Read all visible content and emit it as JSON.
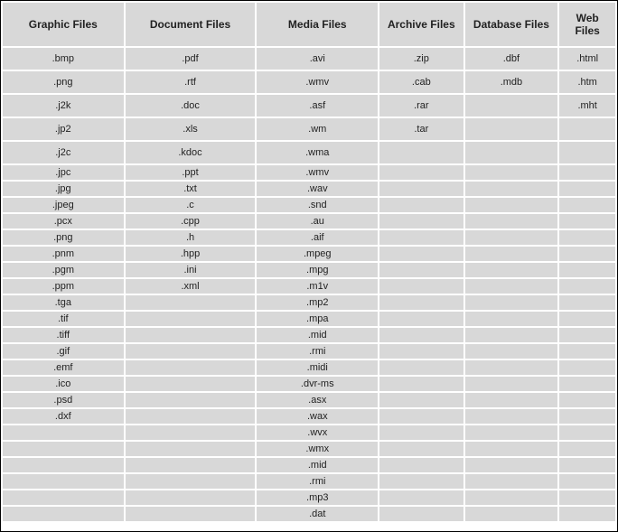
{
  "headers": [
    "Graphic Files",
    "Document Files",
    "Media Files",
    "Archive Files",
    "Database Files",
    "Web Files"
  ],
  "rows": [
    {
      "tall": true,
      "cells": [
        ".bmp",
        ".pdf",
        ".avi",
        ".zip",
        ".dbf",
        ".html"
      ]
    },
    {
      "tall": true,
      "cells": [
        ".png",
        ".rtf",
        ".wmv",
        ".cab",
        ".mdb",
        ".htm"
      ]
    },
    {
      "tall": true,
      "cells": [
        ".j2k",
        ".doc",
        ".asf",
        ".rar",
        "",
        ".mht"
      ]
    },
    {
      "tall": true,
      "cells": [
        ".jp2",
        ".xls",
        ".wm",
        ".tar",
        "",
        ""
      ]
    },
    {
      "tall": true,
      "cells": [
        ".j2c",
        ".kdoc",
        ".wma",
        "",
        "",
        ""
      ]
    },
    {
      "tall": false,
      "cells": [
        ".jpc",
        ".ppt",
        ".wmv",
        "",
        "",
        ""
      ]
    },
    {
      "tall": false,
      "cells": [
        ".jpg",
        ".txt",
        ".wav",
        "",
        "",
        ""
      ]
    },
    {
      "tall": false,
      "cells": [
        ".jpeg",
        ".c",
        ".snd",
        "",
        "",
        ""
      ]
    },
    {
      "tall": false,
      "cells": [
        ".pcx",
        ".cpp",
        ".au",
        "",
        "",
        ""
      ]
    },
    {
      "tall": false,
      "cells": [
        ".png",
        ".h",
        ".aif",
        "",
        "",
        ""
      ]
    },
    {
      "tall": false,
      "cells": [
        ".pnm",
        ".hpp",
        ".mpeg",
        "",
        "",
        ""
      ]
    },
    {
      "tall": false,
      "cells": [
        ".pgm",
        ".ini",
        ".mpg",
        "",
        "",
        ""
      ]
    },
    {
      "tall": false,
      "cells": [
        ".ppm",
        ".xml",
        ".m1v",
        "",
        "",
        ""
      ]
    },
    {
      "tall": false,
      "cells": [
        ".tga",
        "",
        ".mp2",
        "",
        "",
        ""
      ]
    },
    {
      "tall": false,
      "cells": [
        ".tif",
        "",
        ".mpa",
        "",
        "",
        ""
      ]
    },
    {
      "tall": false,
      "cells": [
        ".tiff",
        "",
        ".mid",
        "",
        "",
        ""
      ]
    },
    {
      "tall": false,
      "cells": [
        ".gif",
        "",
        ".rmi",
        "",
        "",
        ""
      ]
    },
    {
      "tall": false,
      "cells": [
        ".emf",
        "",
        ".midi",
        "",
        "",
        ""
      ]
    },
    {
      "tall": false,
      "cells": [
        ".ico",
        "",
        ".dvr-ms",
        "",
        "",
        ""
      ]
    },
    {
      "tall": false,
      "cells": [
        ".psd",
        "",
        ".asx",
        "",
        "",
        ""
      ]
    },
    {
      "tall": false,
      "cells": [
        ".dxf",
        "",
        ".wax",
        "",
        "",
        ""
      ]
    },
    {
      "tall": false,
      "cells": [
        "",
        "",
        ".wvx",
        "",
        "",
        ""
      ]
    },
    {
      "tall": false,
      "cells": [
        "",
        "",
        ".wmx",
        "",
        "",
        ""
      ]
    },
    {
      "tall": false,
      "cells": [
        "",
        "",
        ".mid",
        "",
        "",
        ""
      ]
    },
    {
      "tall": false,
      "cells": [
        "",
        "",
        ".rmi",
        "",
        "",
        ""
      ]
    },
    {
      "tall": false,
      "cells": [
        "",
        "",
        ".mp3",
        "",
        "",
        ""
      ]
    },
    {
      "tall": false,
      "cells": [
        "",
        "",
        ".dat",
        "",
        "",
        ""
      ]
    }
  ]
}
